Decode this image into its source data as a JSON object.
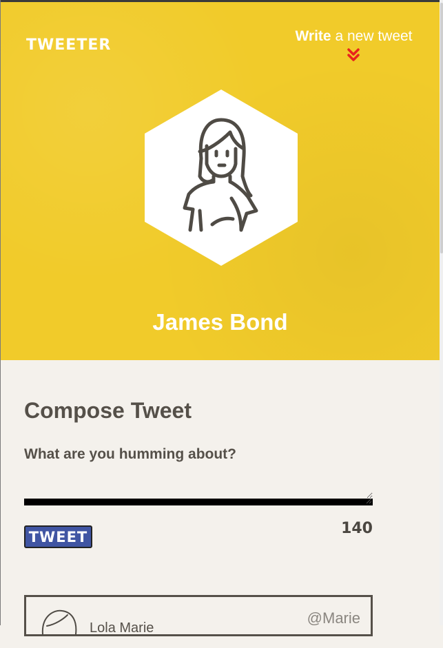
{
  "app": {
    "logo": "TWEETER"
  },
  "nav": {
    "compose_first_word": "Write",
    "compose_rest": " a new tweet"
  },
  "profile": {
    "name": "James Bond"
  },
  "compose": {
    "title": "Compose Tweet",
    "prompt": "What are you humming about?",
    "input_value": "",
    "counter": "140",
    "submit_label": "TWEET"
  },
  "tweets": [
    {
      "name": "Lola Marie",
      "handle": "@Marie"
    }
  ],
  "colors": {
    "hero_background": "#f1cb2a",
    "page_background": "#f4f1ec",
    "text_dark": "#555049",
    "button": "#4055a3",
    "chevron": "#e8231c"
  },
  "icons": {
    "compose_arrow": "chevron-double-down-icon",
    "avatar": "woman-avatar-icon"
  }
}
